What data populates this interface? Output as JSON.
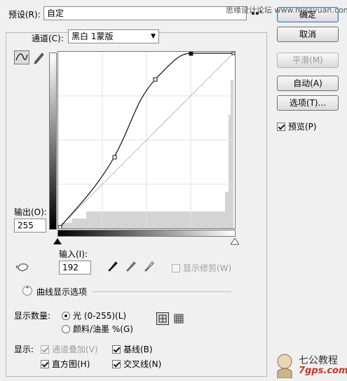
{
  "watermark_top": "思缘设计论坛 www.missyuan.com",
  "preset": {
    "label": "预设(R):",
    "value": "自定",
    "options_icon": "options-icon"
  },
  "channel": {
    "label": "通道(C):",
    "value": "黑白 1蒙版"
  },
  "output": {
    "label": "输出(O):",
    "value": "255"
  },
  "input": {
    "label": "输入(I):",
    "value": "192"
  },
  "show_clipping": "显示修剪(W)",
  "curve_options_label": "曲线显示选项",
  "show_amount": {
    "label": "显示数量:",
    "light": "光 (0-255)(L)",
    "pigment": "颜料/油墨 %(G)",
    "selected": "light"
  },
  "show": {
    "label": "显示:",
    "overlay": "通道叠加(V)",
    "baseline": "基线(B)",
    "histogram": "直方图(H)",
    "intersection": "交叉线(N)"
  },
  "buttons": {
    "ok": "确定",
    "cancel": "取消",
    "smooth": "平滑(M)",
    "auto": "自动(A)",
    "options": "选项(T)...",
    "preview": "预览(P)"
  },
  "watermark_bottom": "七公教程",
  "watermark_url": "7gps.com"
}
